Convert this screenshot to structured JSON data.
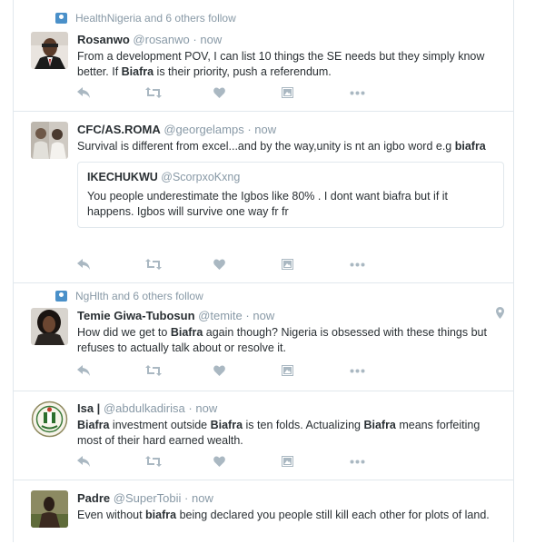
{
  "tweets": [
    {
      "context": "HealthNigeria and 6 others follow",
      "fullname": "Rosanwo",
      "username": "@rosanwo",
      "separator": "·",
      "time": "now",
      "text_html": "From a development POV, I can list 10 things the SE needs but they simply know better. If <b>Biafra</b> is their priority, push a referendum."
    },
    {
      "fullname": "CFC/AS.ROMA",
      "username": "@georgelamps",
      "separator": "·",
      "time": "now",
      "text_html": "Survival is different from excel...and by the way,unity is nt an igbo word e.g <b>biafra</b>",
      "quote": {
        "fullname": "IKECHUKWU",
        "username": "@ScorpxoKxng",
        "text": "You people underestimate the Igbos like 80% . I dont want biafra but if it happens. Igbos will survive one way fr fr"
      }
    },
    {
      "context": "NgHlth and 6 others follow",
      "fullname": "Temie Giwa-Tubosun",
      "username": "@temite",
      "separator": "·",
      "time": "now",
      "text_html": "How did we get to <b>Biafra</b> again though? Nigeria is obsessed with these things but refuses to actually talk about or resolve it."
    },
    {
      "fullname": "Isa |",
      "username": "@abdulkadirisa",
      "separator": "·",
      "time": "now",
      "text_html": "<b>Biafra</b> investment outside <b>Biafra</b> is ten folds. Actualizing <b>Biafra</b> means forfeiting most of their hard earned wealth."
    },
    {
      "fullname": "Padre",
      "username": "@SuperTobii",
      "separator": "·",
      "time": "now",
      "text_html": "Even without <b>biafra</b> being declared you people still kill each other for plots of land."
    }
  ],
  "icons": {
    "reply": "reply-icon",
    "retweet": "retweet-icon",
    "like": "like-icon",
    "media": "media-icon",
    "more": "more-icon",
    "geo": "location-pin-icon",
    "context": "follow-context-icon"
  },
  "colors": {
    "icon_gray": "#aab8c2",
    "meta_gray": "#8899a6",
    "text": "#292f33",
    "border": "#e1e8ed",
    "context_icon": "#4a90c9"
  }
}
